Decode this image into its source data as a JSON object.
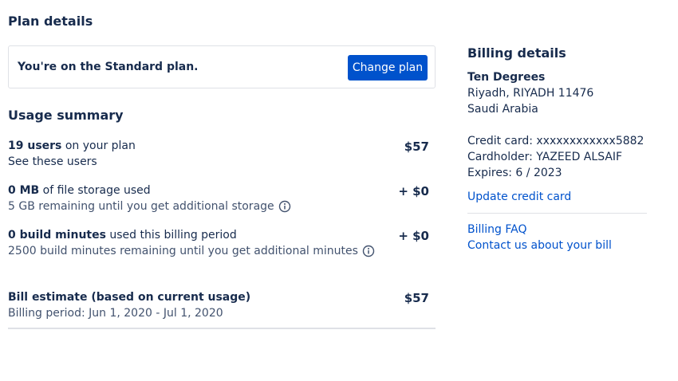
{
  "plan": {
    "heading": "Plan details",
    "current_plan_text": "You're on the Standard plan.",
    "change_plan_label": "Change plan"
  },
  "usage": {
    "heading": "Usage summary",
    "users": {
      "count": "19 users",
      "suffix": " on your plan",
      "link": "See these users",
      "price": "$57"
    },
    "storage": {
      "amount": "0 MB",
      "suffix": " of file storage used",
      "note": "5 GB remaining until you get additional storage",
      "price": "+ $0"
    },
    "build": {
      "amount": "0 build minutes",
      "suffix": " used this billing period",
      "note": "2500 build minutes remaining until you get additional minutes",
      "price": "+ $0"
    },
    "estimate": {
      "label": "Bill estimate (based on current usage)",
      "period": "Billing period: Jun 1, 2020 - Jul 1, 2020",
      "price": "$57"
    }
  },
  "billing": {
    "heading": "Billing details",
    "company": "Ten Degrees",
    "address_line1": "Riyadh, RIYADH 11476",
    "address_line2": "Saudi Arabia",
    "credit_card": "Credit card: xxxxxxxxxxxx5882",
    "cardholder": "Cardholder: YAZEED ALSAIF",
    "expires": "Expires: 6 / 2023",
    "update_card_label": "Update credit card",
    "faq_label": "Billing FAQ",
    "contact_label": "Contact us about your bill"
  },
  "icons": {
    "info": "info-circle-icon"
  },
  "colors": {
    "primary": "#0052cc",
    "text": "#172b4d",
    "subtle_text": "#42526e",
    "border": "#dfe1e6"
  }
}
